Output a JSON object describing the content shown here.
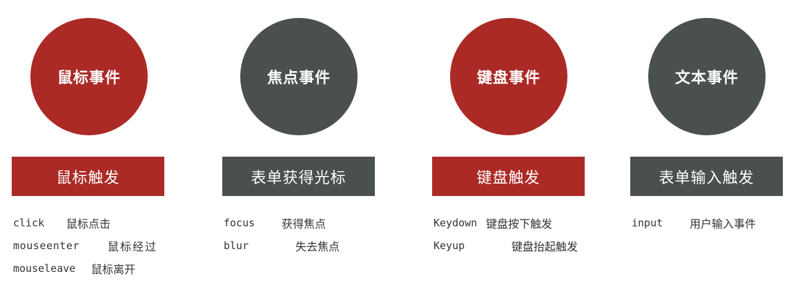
{
  "columns": [
    {
      "circle_label": "鼠标事件",
      "band_label": "鼠标触发",
      "circle_color": "#ab2a26",
      "band_color": "#ab2a26",
      "rows": [
        {
          "code": "click",
          "desc": "鼠标点击"
        },
        {
          "code": "mouseenter",
          "desc": "鼠标经过"
        },
        {
          "code": "mouseleave",
          "desc": "鼠标离开"
        }
      ]
    },
    {
      "circle_label": "焦点事件",
      "band_label": "表单获得光标",
      "circle_color": "#4a4f4f",
      "band_color": "#4a4f4f",
      "rows": [
        {
          "code": "focus",
          "desc": "获得焦点"
        },
        {
          "code": "blur",
          "desc": "失去焦点"
        }
      ]
    },
    {
      "circle_label": "键盘事件",
      "band_label": "键盘触发",
      "circle_color": "#ab2a26",
      "band_color": "#ab2a26",
      "rows": [
        {
          "code": "Keydown",
          "desc": "键盘按下触发"
        },
        {
          "code": "Keyup",
          "desc": "键盘抬起触发"
        }
      ]
    },
    {
      "circle_label": "文本事件",
      "band_label": "表单输入触发",
      "circle_color": "#4a4f4f",
      "band_color": "#4a4f4f",
      "rows": [
        {
          "code": "input",
          "desc": "用户输入事件"
        }
      ]
    }
  ]
}
